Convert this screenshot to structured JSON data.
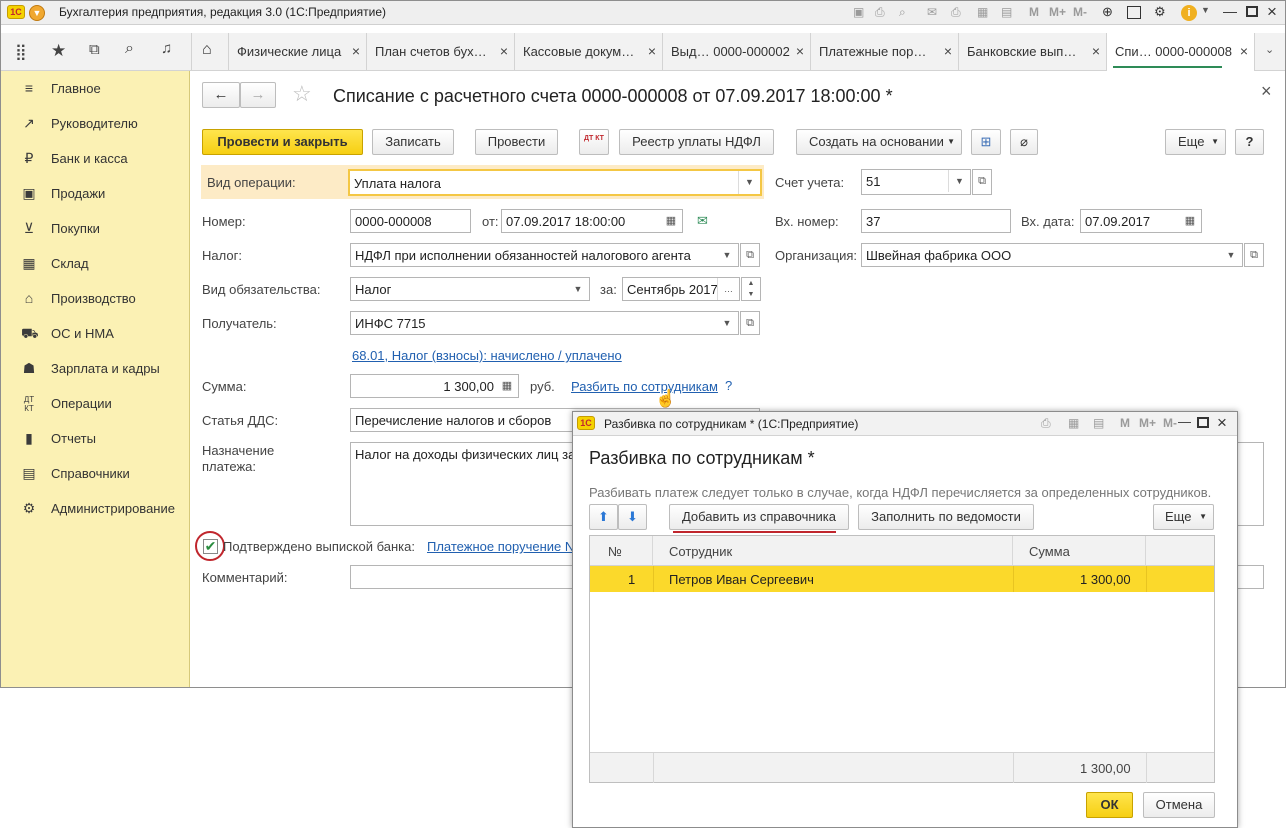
{
  "window": {
    "title": "Бухгалтерия предприятия, редакция 3.0  (1С:Предприятие)",
    "logo": "1С",
    "toolbar_icons": [
      "M",
      "M+",
      "M-"
    ]
  },
  "tabs": [
    {
      "label": "Физические лица"
    },
    {
      "label": "План счетов бух…"
    },
    {
      "label": "Кассовые докум…"
    },
    {
      "label": "Выд… 0000-000002"
    },
    {
      "label": "Платежные пор…"
    },
    {
      "label": "Банковские вып…"
    },
    {
      "label": "Спи… 0000-000008"
    }
  ],
  "sidebar": {
    "items": [
      {
        "label": "Главное",
        "icon": "menu-icon"
      },
      {
        "label": "Руководителю",
        "icon": "chart-line-icon"
      },
      {
        "label": "Банк и касса",
        "icon": "ruble-coin-icon"
      },
      {
        "label": "Продажи",
        "icon": "bag-icon"
      },
      {
        "label": "Покупки",
        "icon": "cart-icon"
      },
      {
        "label": "Склад",
        "icon": "warehouse-icon"
      },
      {
        "label": "Производство",
        "icon": "factory-icon"
      },
      {
        "label": "ОС и НМА",
        "icon": "truck-icon"
      },
      {
        "label": "Зарплата и кадры",
        "icon": "person-icon"
      },
      {
        "label": "Операции",
        "icon": "dt-kt-icon"
      },
      {
        "label": "Отчеты",
        "icon": "bar-chart-icon"
      },
      {
        "label": "Справочники",
        "icon": "book-icon"
      },
      {
        "label": "Администрирование",
        "icon": "gear-icon"
      }
    ]
  },
  "document": {
    "title": "Списание с расчетного счета 0000-000008 от 07.09.2017 18:00:00 *",
    "buttons": {
      "post_close": "Провести и закрыть",
      "save": "Записать",
      "post": "Провести",
      "dtkt": "ДТ КТ",
      "registry": "Реестр уплаты НДФЛ",
      "create_based": "Создать на основании",
      "more": "Еще",
      "help": "?"
    },
    "fields": {
      "op_type_label": "Вид операции:",
      "op_type": "Уплата налога",
      "account_label": "Счет учета:",
      "account": "51",
      "number_label": "Номер:",
      "number": "0000-000008",
      "date_from_label": "от:",
      "date": "07.09.2017 18:00:00",
      "in_number_label": "Вх. номер:",
      "in_number": "37",
      "in_date_label": "Вх. дата:",
      "in_date": "07.09.2017",
      "tax_label": "Налог:",
      "tax": "НДФЛ при исполнении обязанностей налогового агента",
      "org_label": "Организация:",
      "org": "Швейная фабрика ООО",
      "obligation_label": "Вид обязательства:",
      "obligation": "Налог",
      "period_label": "за:",
      "period": "Сентябрь 2017",
      "recipient_label": "Получатель:",
      "recipient": "ИНФС 7715",
      "account_link": "68.01, Налог (взносы): начислено / уплачено",
      "sum_label": "Сумма:",
      "sum": "1 300,00",
      "currency": "руб.",
      "split_link": "Разбить по сотрудникам",
      "split_help": "?",
      "dds_label": "Статья ДДС:",
      "dds": "Перечисление налогов и сборов",
      "purpose_label": "Назначение платежа:",
      "purpose": "Налог на доходы физических лиц за",
      "confirmed_label": "Подтверждено выпиской банка:",
      "payment_link": "Платежное поручение N",
      "comment_label": "Комментарий:",
      "comment": ""
    }
  },
  "dialog": {
    "window_title": "Разбивка по сотрудникам * (1С:Предприятие)",
    "heading": "Разбивка по сотрудникам *",
    "hint": "Разбивать платеж следует только в случае, когда НДФЛ перечисляется за определенных сотрудников.",
    "buttons": {
      "add_from_catalog": "Добавить из справочника",
      "fill_by_statement": "Заполнить по ведомости",
      "more": "Еще",
      "ok": "ОК",
      "cancel": "Отмена"
    },
    "table": {
      "columns": [
        "№",
        "Сотрудник",
        "Сумма"
      ],
      "rows": [
        {
          "num": "1",
          "employee": "Петров Иван Сергеевич",
          "sum": "1 300,00"
        }
      ],
      "total": "1 300,00"
    },
    "toolbar_icons": [
      "M",
      "M+",
      "M-"
    ]
  },
  "colors": {
    "sidebar_bg": "#fbf1b4",
    "accent_yellow": "#f6cf12",
    "selected_row": "#fbd92b",
    "link": "#2160b0",
    "annotation_red": "#c0262d"
  }
}
